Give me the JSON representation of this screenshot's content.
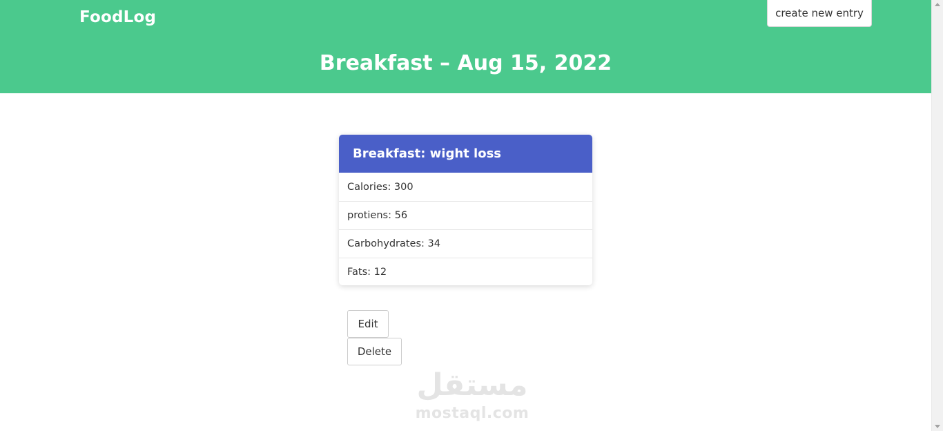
{
  "header": {
    "brand": "FoodLog",
    "create_button": "create new entry",
    "page_title": "Breakfast – Aug 15, 2022",
    "background_color": "#4bc98d"
  },
  "card": {
    "title": "Breakfast: wight loss",
    "header_color": "#4a5fc8",
    "rows": [
      {
        "text": "Calories: 300"
      },
      {
        "text": "protiens: 56"
      },
      {
        "text": "Carbohydrates: 34"
      },
      {
        "text": "Fats: 12"
      }
    ]
  },
  "actions": {
    "edit_label": "Edit",
    "delete_label": "Delete"
  },
  "watermark": {
    "arabic": "مستقل",
    "latin": "mostaql.com"
  },
  "scrollbar": {
    "up_icon": "scroll-up-arrow-icon",
    "down_icon": "scroll-down-arrow-icon"
  }
}
